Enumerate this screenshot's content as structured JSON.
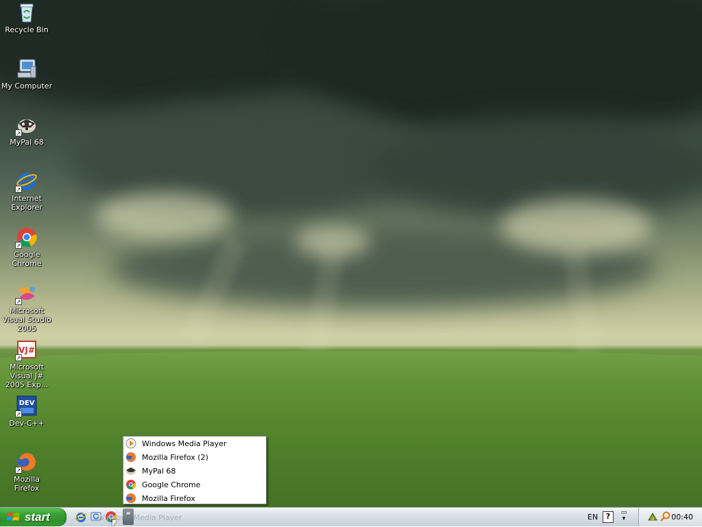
{
  "desktop": {
    "icons": [
      {
        "label": "Recycle Bin",
        "icon": "recycle-bin-icon"
      },
      {
        "label": "My Computer",
        "icon": "my-computer-icon"
      },
      {
        "label": "MyPal 68",
        "icon": "mypal-icon"
      },
      {
        "label": "Internet Explorer",
        "icon": "internet-explorer-icon"
      },
      {
        "label": "Google Chrome",
        "icon": "chrome-icon"
      },
      {
        "label": "Microsoft Visual Studio 2005",
        "icon": "visual-studio-icon"
      },
      {
        "label": "Microsoft Visual J# 2005 Exp...",
        "icon": "visual-jsharp-icon"
      },
      {
        "label": "Dev-C++",
        "icon": "devcpp-icon"
      },
      {
        "label": "Mozilla Firefox",
        "icon": "firefox-icon"
      }
    ]
  },
  "quick_launch_menu": {
    "items": [
      {
        "label": "Windows Media Player",
        "icon": "windows-media-player-icon"
      },
      {
        "label": "Mozilla Firefox (2)",
        "icon": "firefox-icon"
      },
      {
        "label": "MyPal 68",
        "icon": "mypal-icon"
      },
      {
        "label": "Google Chrome",
        "icon": "chrome-icon"
      },
      {
        "label": "Mozilla Firefox",
        "icon": "firefox-icon"
      }
    ]
  },
  "taskbar": {
    "start_label": "start",
    "overflow_label": "»",
    "ghost_text": "Windows Media Player",
    "language": "EN",
    "help_label": "?",
    "clock": "00:40"
  },
  "colors": {
    "start_green": "#3aa534",
    "taskbar": "#d4dbe3",
    "menu_bg": "#ffffff"
  }
}
